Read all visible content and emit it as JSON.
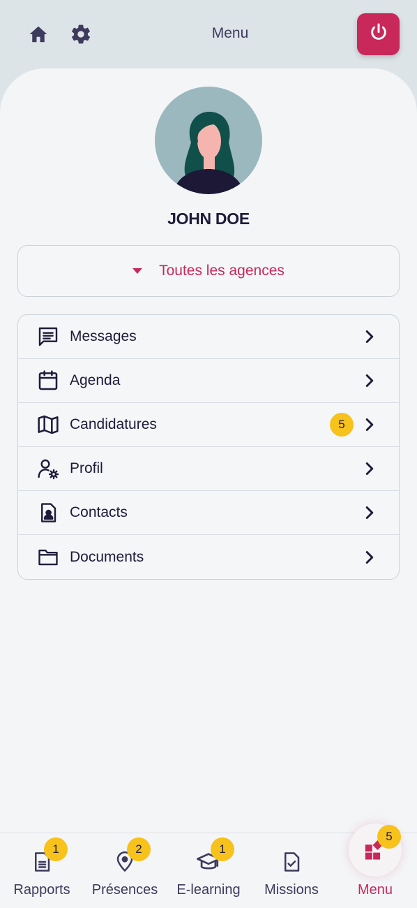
{
  "header": {
    "title": "Menu",
    "icons": {
      "home": "home-icon",
      "settings": "gear-icon",
      "power": "power-icon"
    }
  },
  "profile": {
    "name": "JOHN DOE"
  },
  "agency_select": {
    "label": "Toutes les agences"
  },
  "menu": {
    "items": [
      {
        "label": "Messages",
        "icon": "message-icon"
      },
      {
        "label": "Agenda",
        "icon": "calendar-icon"
      },
      {
        "label": "Candidatures",
        "icon": "map-icon",
        "badge": "5"
      },
      {
        "label": "Profil",
        "icon": "user-settings-icon"
      },
      {
        "label": "Contacts",
        "icon": "contact-card-icon"
      },
      {
        "label": "Documents",
        "icon": "folder-icon"
      }
    ]
  },
  "bottom_nav": {
    "items": [
      {
        "label": "Rapports",
        "badge": "1",
        "icon": "document-icon"
      },
      {
        "label": "Présences",
        "badge": "2",
        "icon": "location-pin-icon"
      },
      {
        "label": "E-learning",
        "badge": "1",
        "icon": "graduation-cap-icon"
      },
      {
        "label": "Missions",
        "badge": "",
        "icon": "checked-document-icon"
      },
      {
        "label": "Menu",
        "badge": "5",
        "icon": "grid-icon",
        "active": true
      }
    ]
  },
  "colors": {
    "accent": "#c8285a",
    "badge": "#f7c21b",
    "text": "#1e1b3a",
    "header_bg": "#dde4e8",
    "sheet_bg": "#f3f5f7"
  }
}
